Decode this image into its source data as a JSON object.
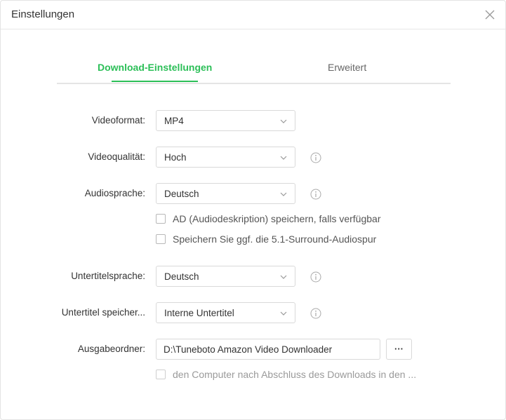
{
  "window": {
    "title": "Einstellungen"
  },
  "tabs": [
    {
      "label": "Download-Einstellungen",
      "active": true
    },
    {
      "label": "Erweitert",
      "active": false
    }
  ],
  "settings": {
    "videoformat": {
      "label": "Videoformat:",
      "value": "MP4"
    },
    "videoqualitaet": {
      "label": "Videoqualität:",
      "value": "Hoch"
    },
    "audiosprache": {
      "label": "Audiosprache:",
      "value": "Deutsch"
    },
    "ad_checkbox": {
      "label": "AD (Audiodeskription) speichern, falls verfügbar",
      "checked": false
    },
    "surround_checkbox": {
      "label": "Speichern Sie ggf. die 5.1-Surround-Audiospur",
      "checked": false
    },
    "untertitelsprache": {
      "label": "Untertitelsprache:",
      "value": "Deutsch"
    },
    "untertitel_speichern": {
      "label": "Untertitel speicher...",
      "value": "Interne Untertitel"
    },
    "ausgabeordner": {
      "label": "Ausgabeordner:",
      "value": "D:\\Tuneboto Amazon Video Downloader",
      "browse_label": "···"
    },
    "shutdown_checkbox": {
      "label": "den Computer nach Abschluss des Downloads in den ...",
      "checked": false
    }
  },
  "colors": {
    "accent": "#2cbf58",
    "border": "#d9d9d9",
    "text": "#333333",
    "disabled_text": "#9a9a9a"
  },
  "icons": {
    "close": "close-icon",
    "dropdown": "chevron-down-icon",
    "info": "info-icon"
  }
}
